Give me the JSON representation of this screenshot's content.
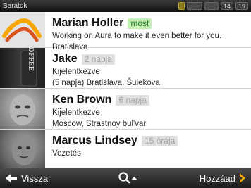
{
  "statusbar": {
    "title": "Barátok",
    "box1": "14",
    "box2": "19"
  },
  "contacts": [
    {
      "name": "Marian Holler",
      "badge": "most",
      "line1": "Working on Aura to make it even better for you.",
      "line2": "Bratislava"
    },
    {
      "name": "Jake",
      "badge": "2 napja",
      "line1": "Kijelentkezve",
      "line2": "(5 napja) Bratislava, Šulekova"
    },
    {
      "name": "Ken Brown",
      "badge": "6 napja",
      "line1": "Kijelentkezve",
      "line2": "Moscow, Strastnoy bul'var"
    },
    {
      "name": "Marcus Lindsey",
      "badge": "15 órája",
      "line1": "Vezetés"
    }
  ],
  "bottombar": {
    "back_label": "Vissza",
    "add_label": "Hozzáad"
  },
  "colors": {
    "accent": "#f7a600",
    "badge_now_bg": "#c5efb4",
    "badge_old_bg": "#e0e0e0"
  }
}
